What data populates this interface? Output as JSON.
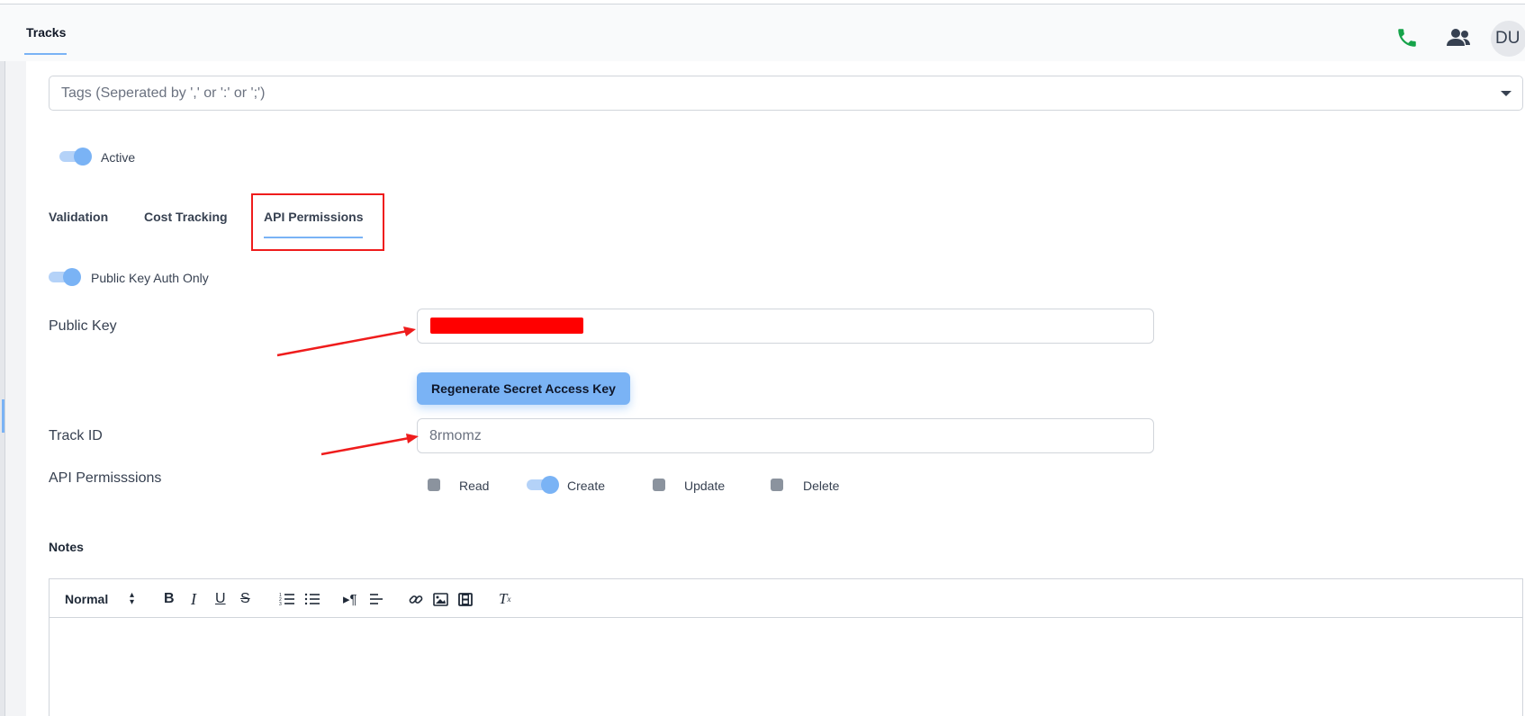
{
  "header": {
    "tab_label": "Tracks",
    "phone_icon": "phone-icon",
    "users_icon": "users-icon",
    "avatar_initials": "DU",
    "colors": {
      "phone": "#16a34a",
      "accent": "#7ab3f5"
    }
  },
  "form": {
    "tags_placeholder": "Tags (Seperated by ',' or ':' or ';')",
    "active_label": "Active",
    "active_on": true,
    "tabs": [
      {
        "label": "Validation"
      },
      {
        "label": "Cost Tracking"
      },
      {
        "label": "API Permissions",
        "active": true
      }
    ],
    "public_key_auth_label": "Public Key Auth Only",
    "public_key_auth_on": true,
    "public_key_label": "Public Key",
    "public_key_value": "",
    "regenerate_label": "Regenerate Secret Access Key",
    "track_id_label": "Track ID",
    "track_id_value": "8rmomz",
    "api_permissions_label": "API Permisssions",
    "permissions": [
      {
        "label": "Read",
        "on": false
      },
      {
        "label": "Create",
        "on": true
      },
      {
        "label": "Update",
        "on": false
      },
      {
        "label": "Delete",
        "on": false
      }
    ],
    "notes_label": "Notes",
    "editor": {
      "format_value": "Normal",
      "toolbar_icons": [
        "bold-icon",
        "italic-icon",
        "underline-icon",
        "strike-icon",
        "ordered-list-icon",
        "bullet-list-icon",
        "rtl-icon",
        "align-icon",
        "link-icon",
        "image-icon",
        "video-icon",
        "clear-format-icon"
      ],
      "bold": "B",
      "italic": "I",
      "underline": "U",
      "strike": "S"
    }
  },
  "annotations": {
    "highlight_color": "#ef1c1c",
    "redaction_color": "#ff0000"
  }
}
